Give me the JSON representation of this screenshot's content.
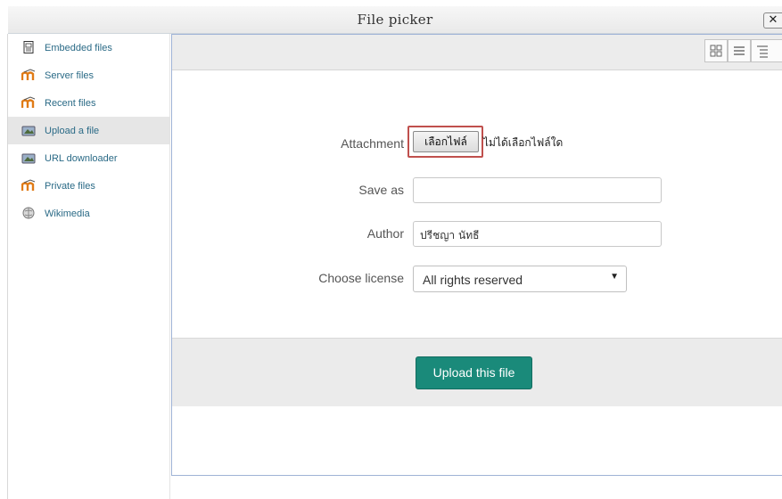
{
  "dialog": {
    "title": "File picker",
    "close_label": "✕"
  },
  "sidebar": {
    "items": [
      {
        "label": "Embedded files",
        "icon": "embedded-file-icon",
        "active": false
      },
      {
        "label": "Server files",
        "icon": "moodle-icon",
        "active": false
      },
      {
        "label": "Recent files",
        "icon": "moodle-icon",
        "active": false
      },
      {
        "label": "Upload a file",
        "icon": "upload-icon",
        "active": true
      },
      {
        "label": "URL downloader",
        "icon": "url-downloader-icon",
        "active": false
      },
      {
        "label": "Private files",
        "icon": "moodle-icon",
        "active": false
      },
      {
        "label": "Wikimedia",
        "icon": "wikimedia-icon",
        "active": false
      }
    ]
  },
  "toolbar": {
    "views": [
      "icon-view",
      "list-view",
      "tree-view"
    ]
  },
  "form": {
    "attachment_label": "Attachment",
    "choose_file_label": "เลือกไฟล์",
    "no_file_text": "ไม่ได้เลือกไฟล์ใด",
    "save_as_label": "Save as",
    "save_as_value": "",
    "author_label": "Author",
    "author_value": "ปรีชญา นัทธี",
    "license_label": "Choose license",
    "license_value": "All rights reserved",
    "upload_label": "Upload this file"
  },
  "colors": {
    "accent": "#1a8a7a",
    "link": "#2a6a86",
    "highlight_border": "#c0504d"
  }
}
